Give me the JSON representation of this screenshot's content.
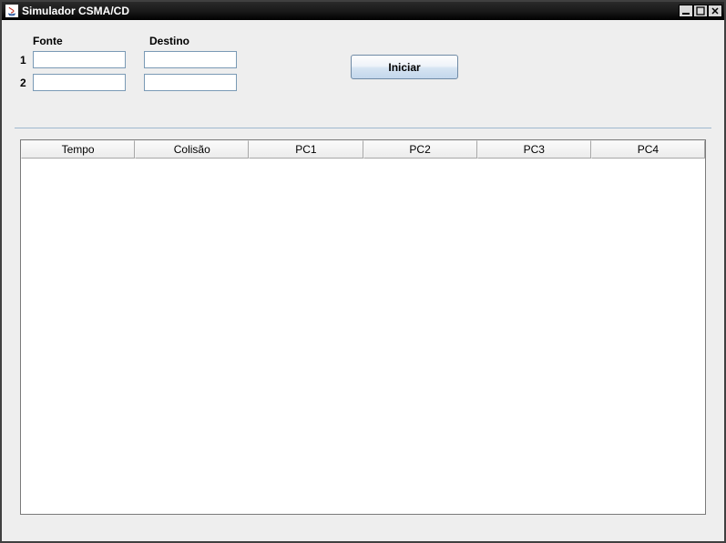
{
  "window": {
    "title": "Simulador CSMA/CD"
  },
  "form": {
    "fonte_label": "Fonte",
    "destino_label": "Destino",
    "rows": {
      "r1": {
        "num": "1",
        "fonte": "",
        "destino": ""
      },
      "r2": {
        "num": "2",
        "fonte": "",
        "destino": ""
      }
    },
    "start_label": "Iniciar"
  },
  "table": {
    "headers": {
      "tempo": "Tempo",
      "colisao": "Colisão",
      "pc1": "PC1",
      "pc2": "PC2",
      "pc3": "PC3",
      "pc4": "PC4"
    }
  }
}
